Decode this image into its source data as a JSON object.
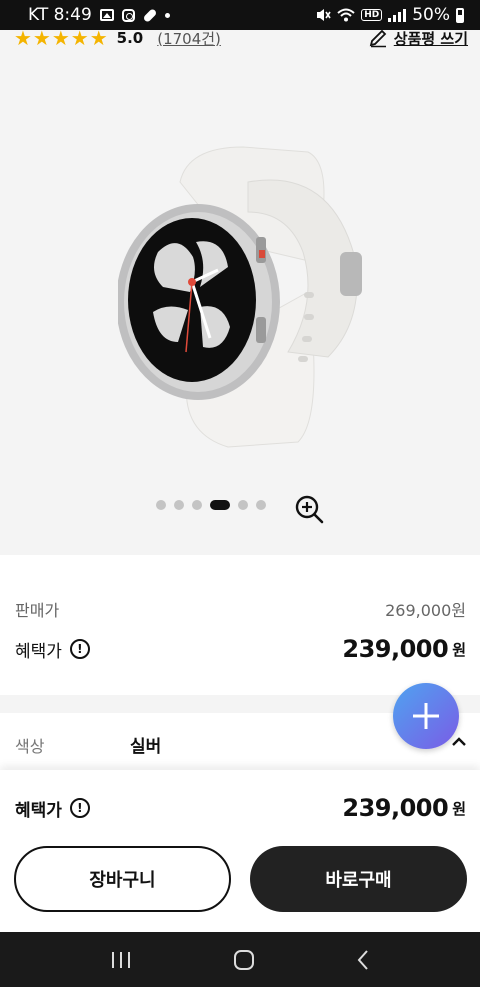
{
  "status_bar": {
    "carrier_time": "KT 8:49",
    "hd": "HD",
    "battery": "50%"
  },
  "rating": {
    "stars": "★★★★★",
    "score": "5.0",
    "count": "(1704건)",
    "write_review": "상품평 쓰기"
  },
  "gallery": {
    "total_images": 6,
    "active_index": 3
  },
  "price": {
    "sale_label": "판매가",
    "sale_value": "269,000원",
    "benefit_label": "혜택가",
    "benefit_value": "239,000",
    "currency": "원"
  },
  "option": {
    "label": "색상",
    "value": "실버"
  },
  "purchase_panel": {
    "benefit_label": "혜택가",
    "benefit_value": "239,000",
    "currency": "원",
    "cart_label": "장바구니",
    "buy_label": "바로구매"
  },
  "colors": {
    "star": "#f4b400",
    "fab_start": "#4fa3f0",
    "fab_end": "#7a5ce6",
    "buy_bg": "#222222"
  }
}
